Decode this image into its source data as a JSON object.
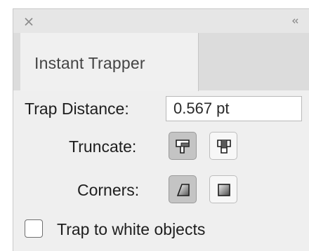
{
  "panel": {
    "tab_label": "Instant Trapper",
    "close_icon": "close-icon",
    "collapse_icon": "double-chevron-icon"
  },
  "trap_distance": {
    "label": "Trap Distance:",
    "value": "0.567 pt"
  },
  "truncate": {
    "label": "Truncate:",
    "options": [
      {
        "icon": "truncate-shape-a-icon",
        "selected": true
      },
      {
        "icon": "truncate-shape-b-icon",
        "selected": false
      }
    ]
  },
  "corners": {
    "label": "Corners:",
    "options": [
      {
        "icon": "corner-beveled-icon",
        "selected": true
      },
      {
        "icon": "corner-square-icon",
        "selected": false
      }
    ]
  },
  "trap_white": {
    "label": "Trap to white objects",
    "checked": false
  }
}
